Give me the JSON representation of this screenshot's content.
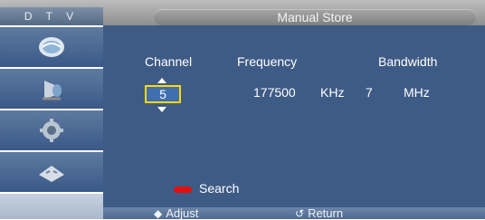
{
  "header": {
    "source_label": "D T V",
    "title": "Manual Store"
  },
  "sidebar": {
    "items": [
      {
        "icon": "picture-menu-icon"
      },
      {
        "icon": "sound-menu-icon"
      },
      {
        "icon": "setup-menu-icon"
      },
      {
        "icon": "input-menu-icon"
      }
    ]
  },
  "main": {
    "columns": {
      "channel": "Channel",
      "frequency": "Frequency",
      "bandwidth": "Bandwidth"
    },
    "channel_value": "5",
    "frequency_value": "177500",
    "frequency_unit": "KHz",
    "bandwidth_value": "7",
    "bandwidth_unit": "MHz",
    "search_label": "Search"
  },
  "footer": {
    "adjust_label": "Adjust",
    "return_label": "Return"
  },
  "colors": {
    "panel": "#3e5b86",
    "highlight_border": "#ffd800",
    "red_key": "#e01010"
  }
}
